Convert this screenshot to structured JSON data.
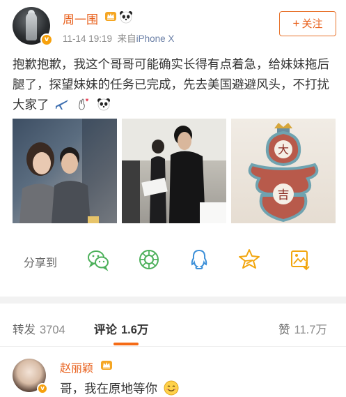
{
  "post": {
    "username": "周一围",
    "time": "11-14 19:19",
    "source_prefix": "来自",
    "source": "iPhone X",
    "follow_label": "关注",
    "text": "抱歉抱歉，我这个哥哥可能确实长得有点着急，给妹妹拖后腿了，探望妹妹的任务已完成，先去美国避避风头，不打扰大家了"
  },
  "share": {
    "label": "分享到",
    "targets": [
      "wechat-icon",
      "moments-icon",
      "qq-icon",
      "qzone-icon",
      "save-image-icon"
    ]
  },
  "tabs": [
    {
      "label": "转发",
      "count": "3704"
    },
    {
      "label": "评论",
      "count": "1.6万",
      "active": true
    },
    {
      "label": "赞",
      "count": "11.7万"
    }
  ],
  "comment": {
    "username": "赵丽颖",
    "text": "哥，我在原地等你"
  },
  "colors": {
    "accent": "#e8601c",
    "underline": "#f56b16",
    "share_green": "#4cb05a",
    "share_blue": "#3b8fd8",
    "share_orange": "#f2a60f",
    "verified": "#f7a10c"
  },
  "photos": [
    "photo-actors-seated",
    "photo-actor-with-script",
    "photo-lucky-charm-ornament"
  ]
}
